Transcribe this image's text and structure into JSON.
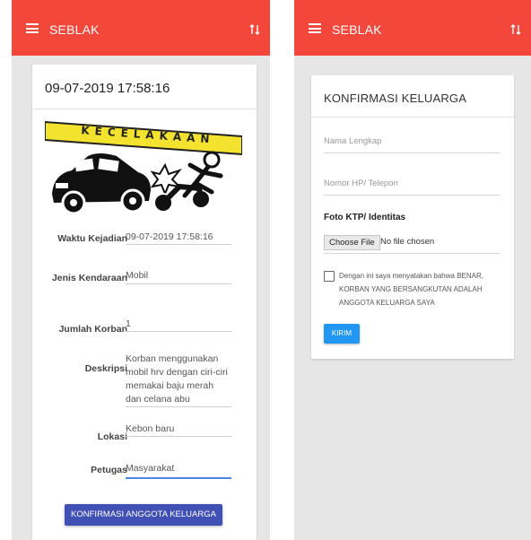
{
  "app": {
    "title": "SEBLAK"
  },
  "left": {
    "date_title": "09-07-2019 17:58:16",
    "hero_banner_text": "KECELAKAAN",
    "fields": [
      {
        "label": "Waktu Kejadian",
        "value": "09-07-2019 17:58:16"
      },
      {
        "label": "Jenis Kendaraan",
        "value": "Mobil"
      },
      {
        "label": "Jumlah Korban",
        "value": "1"
      },
      {
        "label": "Deskripsi",
        "value": "Korban menggunakan mobil hrv dengan ciri-ciri memakai baju merah dan celana abu"
      },
      {
        "label": "Lokasi",
        "value": "Kebon baru"
      },
      {
        "label": "Petugas",
        "value": "Masyarakat"
      }
    ],
    "button": "KONFIRMASI ANGGOTA KELUARGA"
  },
  "right": {
    "title": "KONFIRMASI KELUARGA",
    "nama_placeholder": "Nama Lengkap",
    "nomor_placeholder": "Nomor HP/ Telepon",
    "foto_label": "Foto KTP/ Identitas",
    "choose_file": "Choose File",
    "file_status": "No file chosen",
    "agreement": "Dengan ini saya menyatakan bahwa BENAR, KORBAN YANG BERSANGKUTAN ADALAH ANGGOTA KELUARGA SAYA",
    "submit": "KIRIM"
  },
  "colors": {
    "appbar": "#f4473b",
    "primary_button": "#4150b5",
    "submit_button": "#2196f3",
    "hero_tape": "#f3e32f"
  },
  "icons": [
    "menu-icon",
    "sort-icon",
    "car-crash-illustration"
  ]
}
